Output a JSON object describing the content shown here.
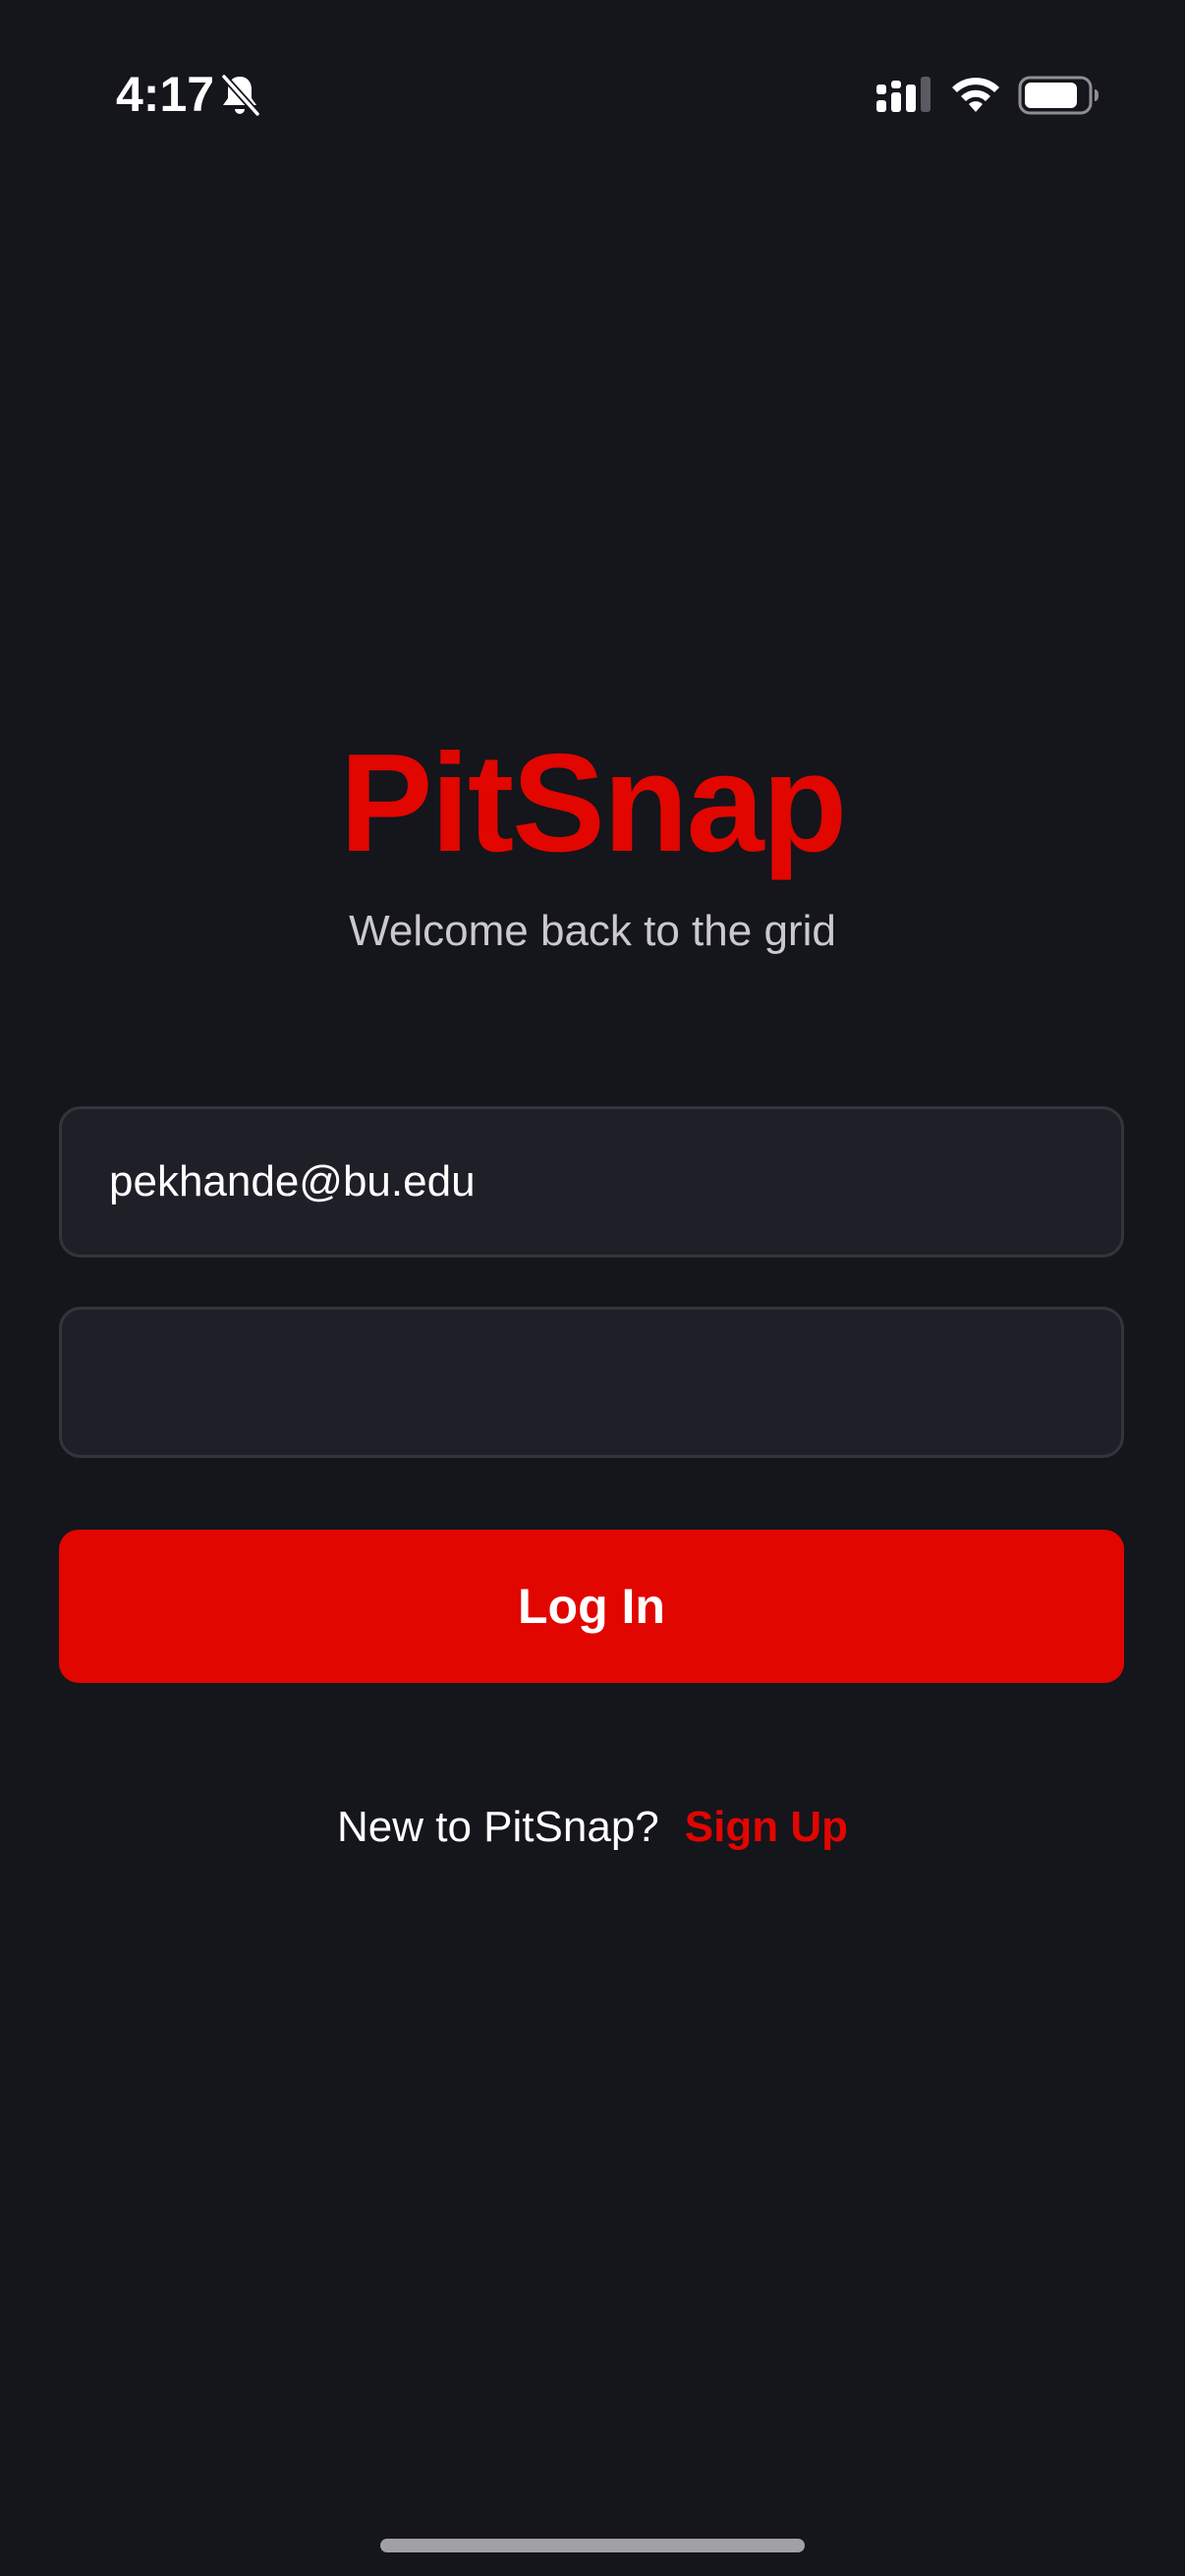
{
  "status_bar": {
    "time": "4:17",
    "icons": [
      "bell-off-icon",
      "signal-icon",
      "wifi-icon",
      "battery-icon"
    ],
    "battery_level": 0.85
  },
  "brand": {
    "title": "PitSnap",
    "subtitle": "Welcome back to the grid"
  },
  "form": {
    "email_value": "pekhande@bu.edu",
    "password_value": "",
    "login_label": "Log In"
  },
  "signup": {
    "prompt": "New to PitSnap?",
    "link_label": "Sign Up"
  },
  "colors": {
    "background": "#15151c",
    "accent": "#e10600",
    "field_background": "#1f1f27",
    "field_border": "#34343c"
  }
}
